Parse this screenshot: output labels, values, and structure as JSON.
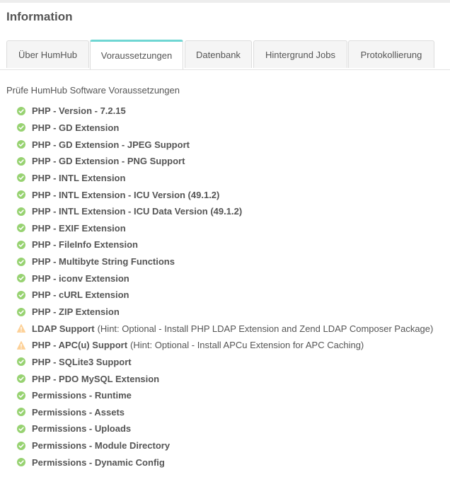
{
  "panel": {
    "title": "Information"
  },
  "tabs": [
    {
      "label": "Über HumHub",
      "active": false
    },
    {
      "label": "Voraussetzungen",
      "active": true
    },
    {
      "label": "Datenbank",
      "active": false
    },
    {
      "label": "Hintergrund Jobs",
      "active": false
    },
    {
      "label": "Protokollierung",
      "active": false
    }
  ],
  "intro": "Prüfe HumHub Software Voraussetzungen",
  "colors": {
    "success": "#97d271",
    "warning": "#fdd198",
    "accent": "#6fd6d3"
  },
  "checks": [
    {
      "status": "success",
      "title": "PHP - Version - 7.2.15",
      "hint": ""
    },
    {
      "status": "success",
      "title": "PHP - GD Extension",
      "hint": ""
    },
    {
      "status": "success",
      "title": "PHP - GD Extension - JPEG Support",
      "hint": ""
    },
    {
      "status": "success",
      "title": "PHP - GD Extension - PNG Support",
      "hint": ""
    },
    {
      "status": "success",
      "title": "PHP - INTL Extension",
      "hint": ""
    },
    {
      "status": "success",
      "title": "PHP - INTL Extension - ICU Version (49.1.2)",
      "hint": ""
    },
    {
      "status": "success",
      "title": "PHP - INTL Extension - ICU Data Version (49.1.2)",
      "hint": ""
    },
    {
      "status": "success",
      "title": "PHP - EXIF Extension",
      "hint": ""
    },
    {
      "status": "success",
      "title": "PHP - FileInfo Extension",
      "hint": ""
    },
    {
      "status": "success",
      "title": "PHP - Multibyte String Functions",
      "hint": ""
    },
    {
      "status": "success",
      "title": "PHP - iconv Extension",
      "hint": ""
    },
    {
      "status": "success",
      "title": "PHP - cURL Extension",
      "hint": ""
    },
    {
      "status": "success",
      "title": "PHP - ZIP Extension",
      "hint": ""
    },
    {
      "status": "warning",
      "title": "LDAP Support",
      "hint": "(Hint: Optional - Install PHP LDAP Extension and Zend LDAP Composer Package)"
    },
    {
      "status": "warning",
      "title": "PHP - APC(u) Support",
      "hint": "(Hint: Optional - Install APCu Extension for APC Caching)"
    },
    {
      "status": "success",
      "title": "PHP - SQLite3 Support",
      "hint": ""
    },
    {
      "status": "success",
      "title": "PHP - PDO MySQL Extension",
      "hint": ""
    },
    {
      "status": "success",
      "title": "Permissions - Runtime",
      "hint": ""
    },
    {
      "status": "success",
      "title": "Permissions - Assets",
      "hint": ""
    },
    {
      "status": "success",
      "title": "Permissions - Uploads",
      "hint": ""
    },
    {
      "status": "success",
      "title": "Permissions - Module Directory",
      "hint": ""
    },
    {
      "status": "success",
      "title": "Permissions - Dynamic Config",
      "hint": ""
    }
  ]
}
